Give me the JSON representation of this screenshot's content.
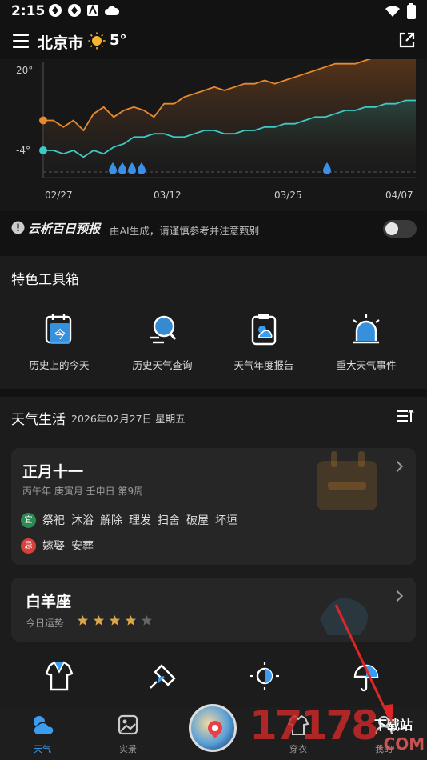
{
  "status": {
    "time": "2:15"
  },
  "header": {
    "city": "北京市",
    "temp": "5°"
  },
  "chart_data": {
    "type": "line",
    "x_ticks": [
      "02/27",
      "03/12",
      "03/25",
      "04/07"
    ],
    "y_ticks": [
      "20°",
      "-4°"
    ],
    "series": [
      {
        "values": [
          5,
          5,
          3,
          5,
          2,
          7,
          9,
          6,
          8,
          9,
          8,
          6,
          10,
          10,
          12,
          13,
          14,
          15,
          14,
          15,
          16,
          16,
          17,
          16,
          17,
          18,
          19,
          20,
          21,
          22,
          22,
          22,
          23,
          24,
          25,
          26,
          27,
          27
        ],
        "color": "#e8892d"
      },
      {
        "values": [
          -4,
          -4,
          -5,
          -4,
          -6,
          -4,
          -5,
          -3,
          -2,
          0,
          0,
          1,
          1,
          0,
          0,
          1,
          2,
          2,
          1,
          1,
          2,
          2,
          3,
          3,
          4,
          4,
          5,
          6,
          6,
          7,
          8,
          8,
          9,
          9,
          10,
          10,
          11,
          11
        ],
        "color": "#3ec9c6"
      }
    ]
  },
  "ai": {
    "title": "云析百日预报",
    "desc": "由AI生成，请谨慎参考并注意甄别"
  },
  "tools": {
    "title": "特色工具箱",
    "items": [
      {
        "label": "历史上的今天",
        "icon_char": "今"
      },
      {
        "label": "历史天气查询"
      },
      {
        "label": "天气年度报告"
      },
      {
        "label": "重大天气事件"
      }
    ]
  },
  "life": {
    "title": "天气生活",
    "date": "2026年02月27日 星期五",
    "lunar": {
      "title": "正月十一",
      "sub": "丙午年 庚寅月 壬申日 第9周",
      "yi_label": "宜",
      "yi": [
        "祭祀",
        "沐浴",
        "解除",
        "理发",
        "扫舍",
        "破屋",
        "坏垣"
      ],
      "ji_label": "忌",
      "ji": [
        "嫁娶",
        "安葬"
      ]
    },
    "zodiac": {
      "title": "白羊座",
      "sub": "今日运势",
      "rating": 4,
      "max": 5
    }
  },
  "tabbar": {
    "tabs": [
      "天气",
      "实景",
      "穿衣",
      "我的"
    ]
  },
  "watermark": {
    "num": "17178",
    "zz": "下载站",
    "com": ".COM"
  },
  "colors": {
    "accent": "#3a9df2",
    "orange": "#e8892d",
    "cyan": "#3ec9c6",
    "rain": "#3a8fe6"
  }
}
